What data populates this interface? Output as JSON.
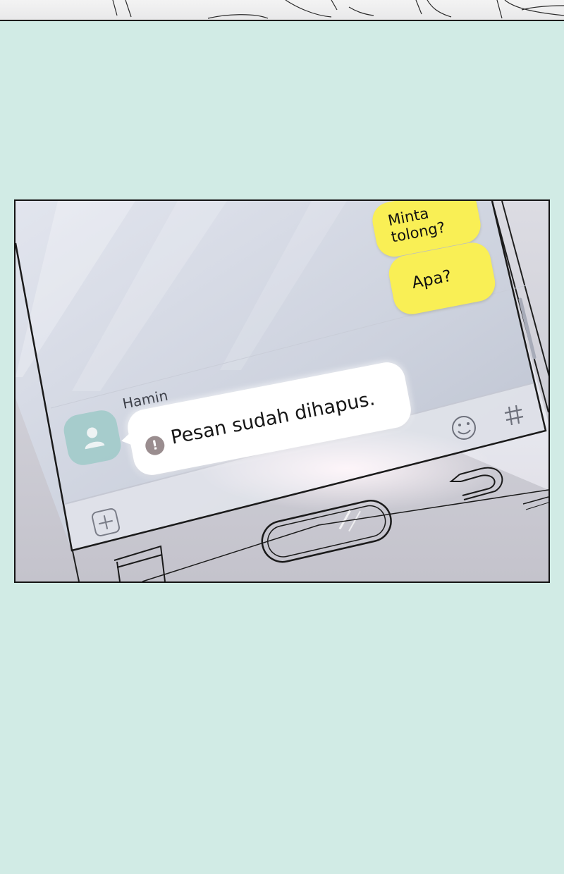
{
  "chat": {
    "outgoing_messages": [
      {
        "text": "Minta\ntolong?"
      },
      {
        "text": "Apa?"
      }
    ],
    "incoming": {
      "sender": "Hamin",
      "message": "Pesan sudah dihapus.",
      "warning_glyph": "!"
    }
  },
  "icons": {
    "avatar": "person-icon",
    "emoji": "smiley-icon",
    "hashtag": "hashtag-icon",
    "attach": "plus-icon",
    "back": "back-arrow-icon",
    "home": "home-button-icon"
  },
  "colors": {
    "page_background": "#d1ebe5",
    "outgoing_bubble": "#f9ef55",
    "incoming_bubble": "#ffffff",
    "avatar": "#a2cbca",
    "warning_icon": "#9a8d8f"
  }
}
